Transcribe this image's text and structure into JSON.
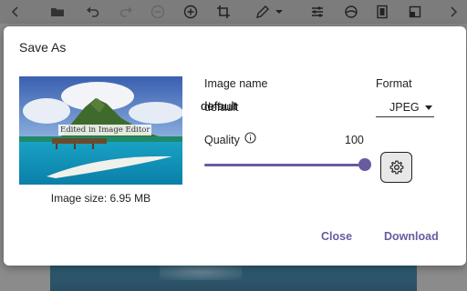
{
  "toolbar": {
    "icons": [
      "chevron-left-icon",
      "folder-icon",
      "undo-icon",
      "redo-icon",
      "remove-icon",
      "add-icon",
      "crop-icon",
      "pen-icon",
      "chevron-down-icon",
      "adjust-icon",
      "layers-icon",
      "frame-icon",
      "flip-icon",
      "chevron-right-icon"
    ]
  },
  "dialog": {
    "title": "Save As",
    "image_caption": "Edited in Image Editor",
    "image_size": "Image size: 6.95 MB",
    "image_name_label": "Image name",
    "image_name_value": "default",
    "format_label": "Format",
    "format_value": "JPEG",
    "quality_label": "Quality",
    "quality_value": "100",
    "quality_fraction": 1.0,
    "close_label": "Close",
    "download_label": "Download"
  },
  "colors": {
    "accent": "#6a5aa0",
    "accent_light": "#c9bfe0"
  }
}
